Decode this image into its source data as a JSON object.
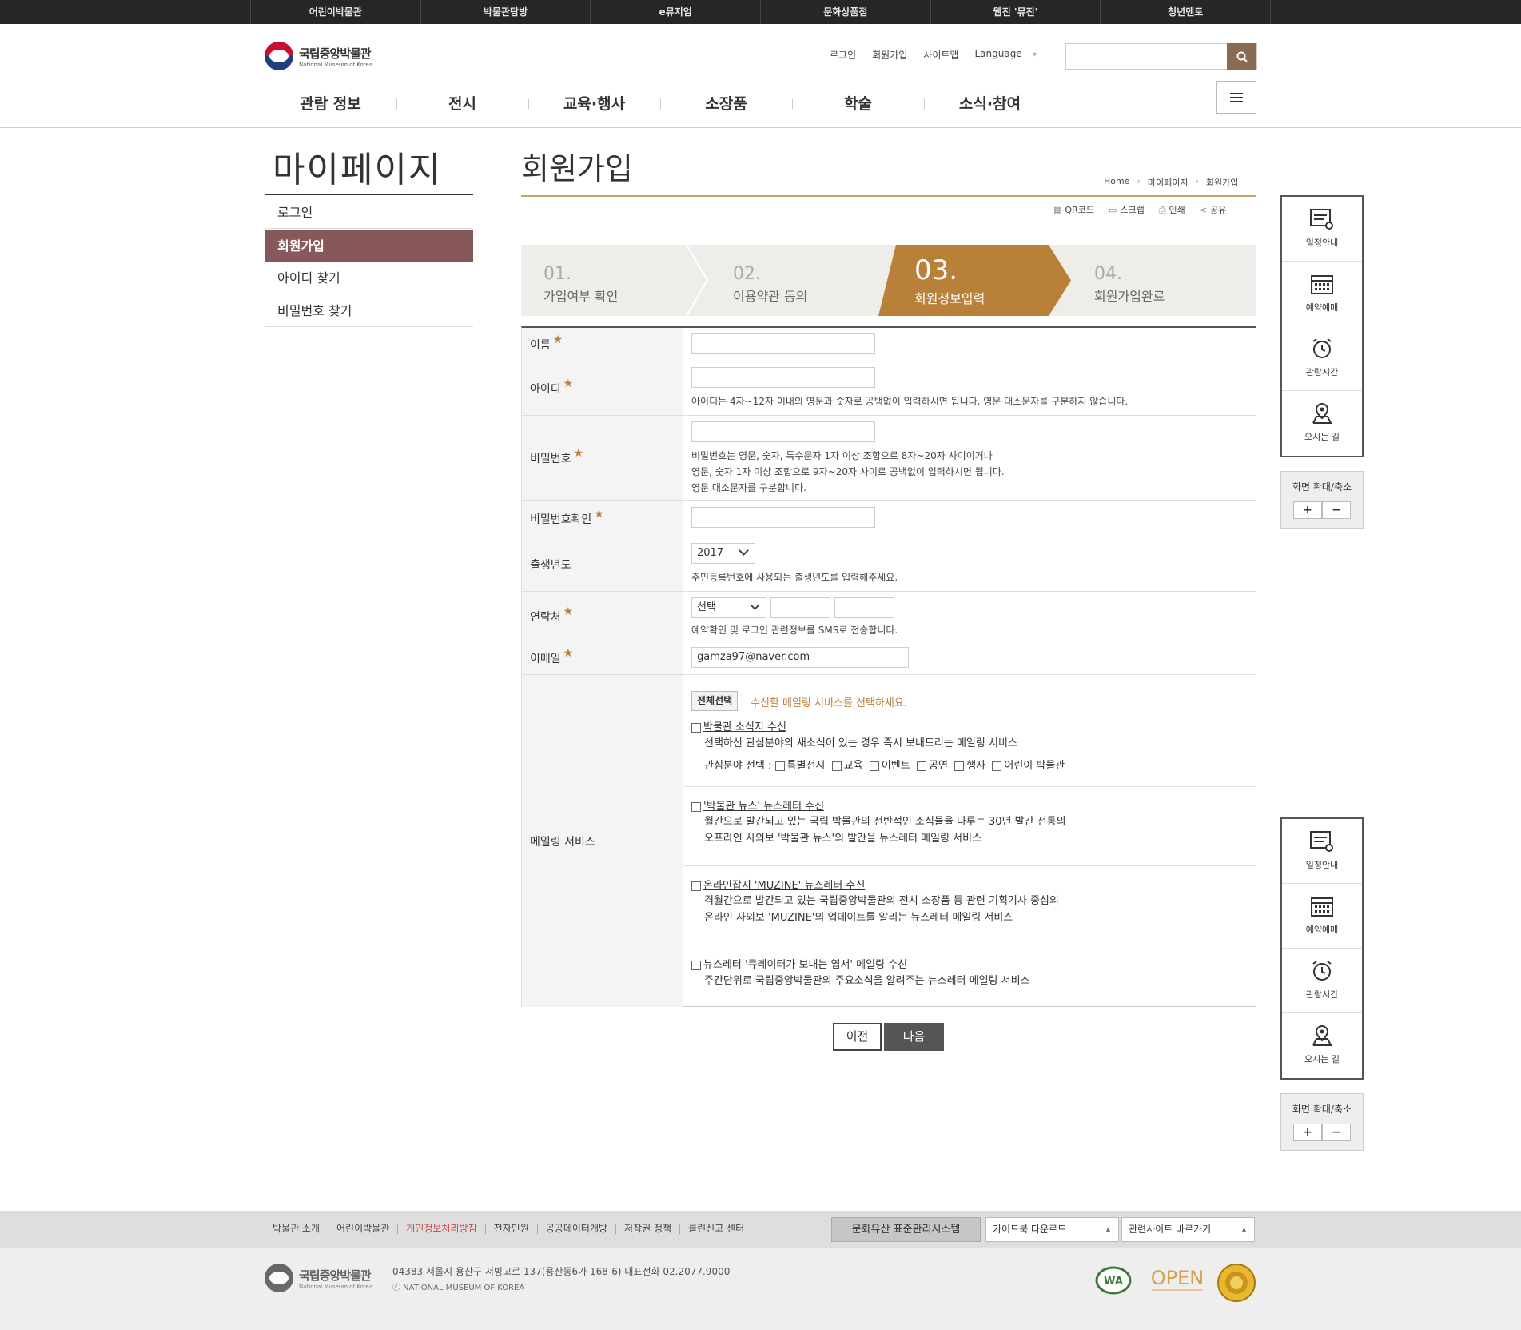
{
  "top_links": [
    "어린이박물관",
    "박물관탐방",
    "e뮤지엄",
    "문화상품점",
    "웹진 '뮤진'",
    "청년멘토"
  ],
  "logo": {
    "ko": "국립중앙박물관",
    "en": "National Museum of Korea"
  },
  "utils": {
    "login": "로그인",
    "join": "회원가입",
    "sitemap": "사이트맵",
    "language": "Language"
  },
  "search": {
    "placeholder": ""
  },
  "gnb": [
    "관람 정보",
    "전시",
    "교육·행사",
    "소장품",
    "학술",
    "소식·참여"
  ],
  "lnb": {
    "title": "마이페이지",
    "items": [
      "로그인",
      "회원가입",
      "아이디 찾기",
      "비밀번호 찾기"
    ],
    "active_index": 1
  },
  "content": {
    "title": "회원가입",
    "breadcrumb": [
      "Home",
      "마이페이지",
      "회원가입"
    ]
  },
  "tools": [
    "QR코드",
    "스크랩",
    "인쇄",
    "공유"
  ],
  "steps": [
    {
      "num": "01.",
      "label": "가입여부 확인"
    },
    {
      "num": "02.",
      "label": "이용약관 동의"
    },
    {
      "num": "03.",
      "label": "회원정보입력"
    },
    {
      "num": "04.",
      "label": "회원가입완료"
    }
  ],
  "active_step": 3,
  "form": {
    "name_label": "이름",
    "id_label": "아이디",
    "id_help": "아이디는 4자~12자 이내의 영문과 숫자로 공백없이 입력하시면 됩니다. 영문 대소문자를 구분하지 않습니다.",
    "pw_label": "비밀번호",
    "pw_help": [
      "비밀번호는 영문, 숫자, 특수문자 1자 이상 조합으로 8자~20자 사이이거나",
      "영문, 숫자 1자 이상 조합으로 9자~20자 사이로 공백없이 입력하시면 됩니다.",
      "영문 대소문자를 구분합니다."
    ],
    "pw_confirm_label": "비밀번호확인",
    "birth_label": "출생년도",
    "birth_value": "2017",
    "birth_help": "주민등록번호에 사용되는 출생년도를 입력해주세요.",
    "phone_label": "연락처",
    "phone_select": "선택",
    "phone_help": "예약확인 및 로그인 관련정보를 SMS로 전송합니다.",
    "email_label": "이메일",
    "email_value": "gamza97@naver.com",
    "mailing_label": "메일링 서비스",
    "select_all": "전체선택",
    "select_hint": "수신할 메일링 서비스를 선택하세요.",
    "mailing": [
      {
        "title": "박물관 소식지 수신",
        "desc": [
          "선택하신 관심분야의 새소식이 있는 경우 즉시 보내드리는 메일링 서비스"
        ]
      },
      {
        "title": "'박물관 뉴스' 뉴스레터 수신",
        "desc": [
          "월간으로 발간되고 있는 국립 박물관의 전반적인 소식들을 다루는 30년 발간 전통의",
          "오프라인 사외보 '박물관 뉴스'의 발간을 뉴스레터 메일링 서비스"
        ]
      },
      {
        "title": "온라인잡지 'MUZINE' 뉴스레터 수신",
        "desc": [
          "격월간으로 발간되고 있는 국립중앙박물관의 전시 소장품 등 관련 기획기사 중심의",
          "온라인 사외보 'MUZINE'의 업데이트를 알리는 뉴스레터 메일링 서비스"
        ]
      },
      {
        "title": "뉴스레터 '큐레이터가 보내는 엽서' 메일링 수신",
        "desc": [
          "주간단위로 국립중앙박물관의 주요소식을 알려주는 뉴스레터 메일링 서비스"
        ]
      }
    ],
    "interest_label": "관심분야 선택 :",
    "interests": [
      "특별전시",
      "교육",
      "이벤트",
      "공연",
      "행사",
      "어린이 박물관"
    ]
  },
  "buttons": {
    "prev": "이전",
    "next": "다음"
  },
  "quick": {
    "items": [
      "일정안내",
      "예약예매",
      "관람시간",
      "오시는 길"
    ],
    "zoom_label": "화면 확대/축소",
    "zoom_in": "+",
    "zoom_out": "−"
  },
  "footer": {
    "links": [
      "박물관 소개",
      "어린이박물관",
      "개인정보처리방침",
      "전자민원",
      "공공데이터개방",
      "저작권 정책",
      "클린신고 센터"
    ],
    "highlight_index": 2,
    "btn_heritage": "문화유산 표준관리시스템",
    "guidebook": "가이드북 다운로드",
    "related": "관련사이트 바로가기",
    "address": "04383 서울시 용산구 서빙고로 137(용산동6가 168-6)    대표전화 02.2077.9000",
    "copyright": "ⓒ NATIONAL MUSEUM OF KOREA",
    "badges": [
      "WA",
      "OPEN"
    ]
  },
  "colors": {
    "accent": "#b9803a",
    "lnb_active": "#87585a",
    "topbar": "#262626",
    "search_btn": "#8a6b52"
  }
}
